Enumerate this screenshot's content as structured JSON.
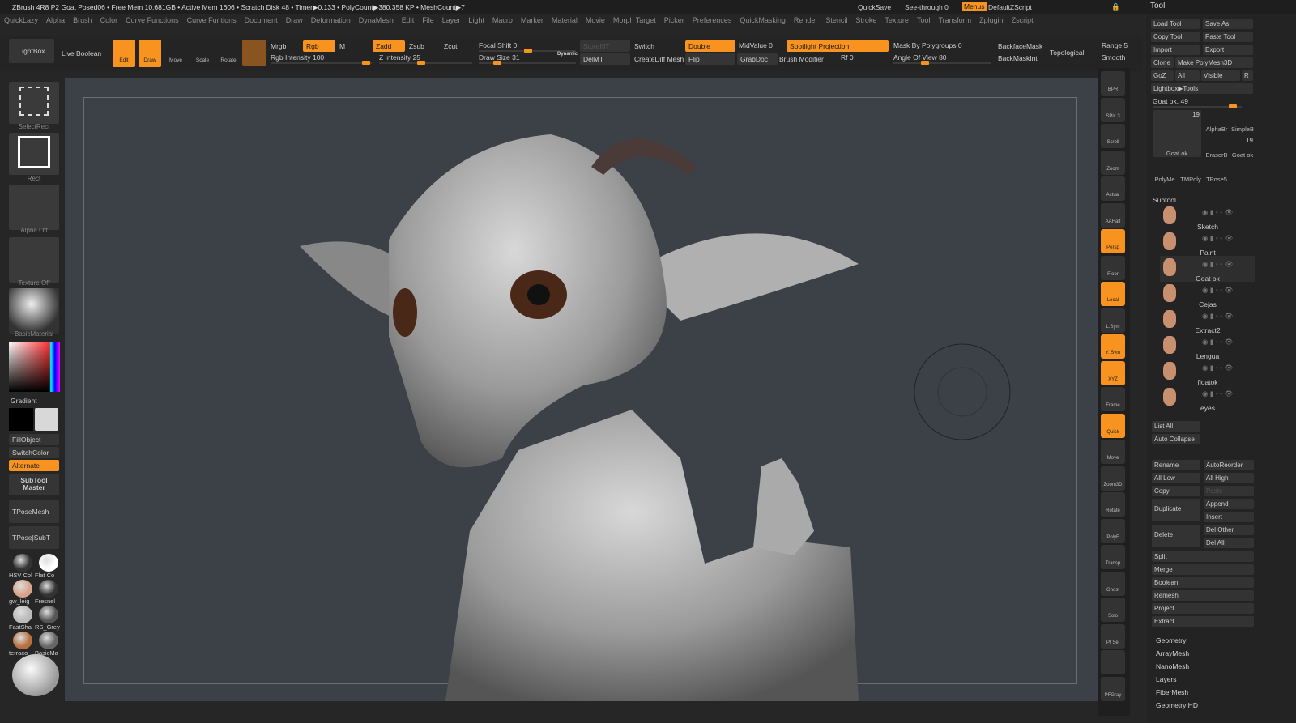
{
  "titlebar": {
    "text": "ZBrush 4R8 P2 Goat Posed06   • Free Mem 10.681GB • Active Mem 1606 • Scratch Disk 48 •  Timer▶0.133 • PolyCount▶380.358 KP  • MeshCount▶7",
    "quicksave": "QuickSave",
    "seethrough": "See-through  0",
    "menus": "Menus",
    "script": "DefaultZScript",
    "tool_title": "Tool"
  },
  "menus": [
    "QuickLazy",
    "Alpha",
    "Brush",
    "Color",
    "Curve Functions",
    "Curve Funtions",
    "Document",
    "Draw",
    "Deformation",
    "DynaMesh",
    "Edit",
    "File",
    "Layer",
    "Light",
    "Macro",
    "Marker",
    "Material",
    "Movie",
    "Morph Target",
    "Picker",
    "Preferences",
    "QuickMasking",
    "Render",
    "Stencil",
    "Stroke",
    "Texture",
    "Tool",
    "Transform",
    "Zplugin",
    "Zscript"
  ],
  "toolbar": {
    "lightbox": "LightBox",
    "live_boolean": "Live Boolean",
    "edit": "Edit",
    "draw": "Draw",
    "move": "Move",
    "scale": "Scale",
    "rotate": "Rotate",
    "mrgb": "Mrgb",
    "rgb": "Rgb",
    "m": "M",
    "zadd": "Zadd",
    "zsub": "Zsub",
    "zcut": "Zcut",
    "rgb_intensity": "Rgb Intensity 100",
    "z_intensity": "Z Intensity 25",
    "focal_shift": "Focal Shift 0",
    "draw_size": "Draw Size 31",
    "dynamic": "Dynamic",
    "storemt": "StoreMT",
    "delmt": "DelMT",
    "switch": "Switch",
    "creatediff": "CreateDiff Mesh",
    "double": "Double",
    "flip": "Flip",
    "midvalue": "MidValue 0",
    "grabdoc": "GrabDoc",
    "spotlight": "Spotlight Projection",
    "brush_modifier": "Brush Modifier",
    "rf": "Rf 0",
    "mask_polygroups": "Mask By Polygroups 0",
    "angle_of_view": "Angle Of View 80",
    "backfacemask": "BackfaceMask",
    "backmaskint": "BackMaskInt",
    "topological": "Topological",
    "range": "Range 5",
    "smooth": "Smooth",
    "values": {
      "rgb_intensity": 100,
      "z_intensity": 25,
      "focal_shift": 0,
      "draw_size": 31
    }
  },
  "left": {
    "selectrect": "SelectRect",
    "rect": "Rect",
    "alpha": "Alpha Off",
    "texture": "Texture Off",
    "material": "BasicMaterial",
    "gradient": "Gradient",
    "fillobject": "FillObject",
    "switchcolor": "SwitchColor",
    "alternate": "Alternate",
    "subtool_master": "SubTool Master",
    "tposemesh": "TPoseMesh",
    "tposesubt": "TPose|SubT",
    "materials": [
      "HSV Col",
      "Flat Co",
      "gw_leig",
      "Fresnel",
      "FastSha",
      "RS_Grey",
      "terraco",
      "BasicMa"
    ]
  },
  "rightshelf": [
    "BPR",
    "SPix 3",
    "Scroll",
    "Zoom",
    "Actual",
    "AAHalf",
    "Persp",
    "Floor",
    "Local",
    "L.Sym",
    "Y. Sym",
    "XYZ",
    "Frame",
    "Quick",
    "Move",
    "Zoom3D",
    "Rotate",
    "PolyF",
    "Transp",
    "Ghost",
    "Solo",
    "Pt Sel",
    "",
    "PFGray"
  ],
  "tool": {
    "load": "Load Tool",
    "save_as": "Save As",
    "copy": "Copy Tool",
    "paste": "Paste Tool",
    "import": "Import",
    "export": "Export",
    "clone": "Clone",
    "make_polymesh": "Make PolyMesh3D",
    "goz": "GoZ",
    "all": "All",
    "visible": "Visible",
    "r": "R",
    "lightbox_tools": "Lightbox▶Tools",
    "current": "Goat ok. 49",
    "current_value": 49,
    "thumbs": [
      {
        "label": "Goat ok",
        "count": "19"
      },
      {
        "label": "AlphaBr"
      },
      {
        "label": "SimpleB"
      },
      {
        "label": "EraserB"
      },
      {
        "label": "Goat ok",
        "count": "19"
      },
      {
        "label": "PolyMe"
      },
      {
        "label": "TMPoly"
      },
      {
        "label": "TPose5"
      }
    ],
    "subtool_title": "Subtool",
    "subtools": [
      "Sketch",
      "Paint",
      "Goat ok",
      "Cejas",
      "Extract2",
      "Lengua",
      "floatok",
      "eyes"
    ],
    "list_all": "List All",
    "auto_collapse": "Auto Collapse",
    "rename": "Rename",
    "autoreorder": "AutoReorder",
    "all_low": "All Low",
    "all_high": "All High",
    "copy2": "Copy",
    "paste2": "Paste",
    "duplicate": "Duplicate",
    "append": "Append",
    "insert": "Insert",
    "delete": "Delete",
    "del_other": "Del Other",
    "del_all": "Del All",
    "actions": [
      "Split",
      "Merge",
      "Boolean",
      "Remesh",
      "Project",
      "Extract"
    ],
    "sections": [
      "Geometry",
      "ArrayMesh",
      "NanoMesh",
      "Layers",
      "FiberMesh",
      "Geometry HD"
    ]
  },
  "colors": {
    "accent": "#f7931e",
    "viewport": "#3c4148"
  }
}
